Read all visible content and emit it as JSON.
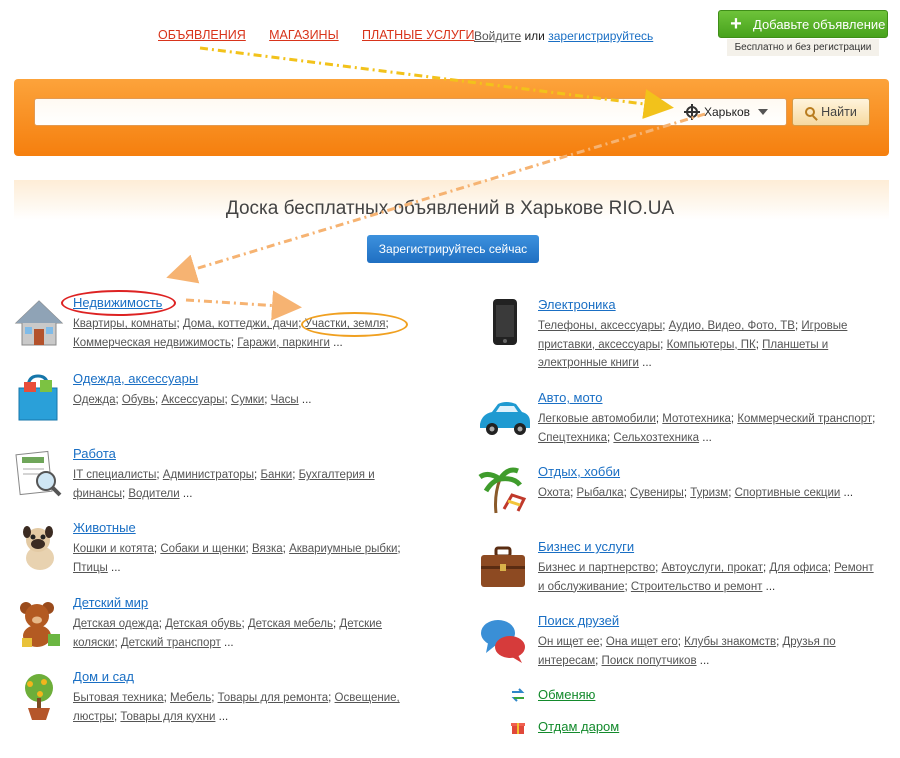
{
  "nav": {
    "items": [
      "ОБЪЯВЛЕНИЯ",
      "МАГАЗИНЫ",
      "ПЛАТНЫЕ УСЛУГИ"
    ],
    "login": "Войдите",
    "or": "или",
    "register": "зарегистрируйтесь"
  },
  "add_ad": {
    "label": "Добавьте объявление",
    "note": "Бесплатно и без регистрации"
  },
  "search": {
    "city": "Харьков",
    "button": "Найти"
  },
  "headline": "Доска бесплатных объявлений в Харькове RIO.UA",
  "register_now": "Зарегистрируйтесь сейчас",
  "categories_left": [
    {
      "title": "Недвижимость",
      "icon": "house-icon",
      "links": [
        "Квартиры, комнаты",
        "Дома, коттеджи, дачи",
        "Участки, земля",
        "Коммерческая недвижимость",
        "Гаражи, паркинги"
      ]
    },
    {
      "title": "Одежда, аксессуары",
      "icon": "shopping-bag-icon",
      "links": [
        "Одежда",
        "Обувь",
        "Аксессуары",
        "Сумки",
        "Часы"
      ]
    },
    {
      "title": "Работа",
      "icon": "resume-icon",
      "links": [
        "IT специалисты",
        "Администраторы",
        "Банки",
        "Бухгалтерия и финансы",
        "Водители"
      ]
    },
    {
      "title": "Животные",
      "icon": "pug-dog-icon",
      "links": [
        "Кошки и котята",
        "Собаки и щенки",
        "Вязка",
        "Аквариумные рыбки",
        "Птицы"
      ]
    },
    {
      "title": "Детский мир",
      "icon": "teddy-bear-icon",
      "links": [
        "Детская одежда",
        "Детская обувь",
        "Детская мебель",
        "Детские коляски",
        "Детский транспорт"
      ]
    },
    {
      "title": "Дом и сад",
      "icon": "potted-tree-icon",
      "links": [
        "Бытовая техника",
        "Мебель",
        "Товары для ремонта",
        "Освещение, люстры",
        "Товары для кухни"
      ]
    }
  ],
  "categories_right": [
    {
      "title": "Электроника",
      "icon": "smartphone-icon",
      "links": [
        "Телефоны, аксессуары",
        "Аудио, Видео, Фото, ТВ",
        "Игровые приставки, аксессуары",
        "Компьютеры, ПК",
        "Планшеты и электронные книги"
      ]
    },
    {
      "title": "Авто, мото",
      "icon": "car-icon",
      "links": [
        "Легковые автомобили",
        "Мототехника",
        "Коммерческий транспорт",
        "Спецтехника",
        "Сельхозтехника"
      ]
    },
    {
      "title": "Отдых, хобби",
      "icon": "palm-chair-icon",
      "links": [
        "Охота",
        "Рыбалка",
        "Сувениры",
        "Туризм",
        "Спортивные секции"
      ]
    },
    {
      "title": "Бизнес и услуги",
      "icon": "briefcase-icon",
      "links": [
        "Бизнес и партнерство",
        "Автоуслуги, прокат",
        "Для офиса",
        "Ремонт и обслуживание",
        "Строительство и ремонт"
      ]
    },
    {
      "title": "Поиск друзей",
      "icon": "chat-bubbles-icon",
      "links": [
        "Он ищет ее",
        "Она ищет его",
        "Клубы знакомств",
        "Друзья по интересам",
        "Поиск попутчиков"
      ]
    }
  ],
  "extra_links": [
    {
      "label": "Обменяю",
      "icon": "exchange-arrows-icon"
    },
    {
      "label": "Отдам даром",
      "icon": "gift-icon"
    }
  ],
  "ellipsis": "...",
  "colors": {
    "orange_band": "#f68a1e",
    "link_blue": "#1a6fc4",
    "nav_red": "#d8341b",
    "green": "#4caf22"
  }
}
